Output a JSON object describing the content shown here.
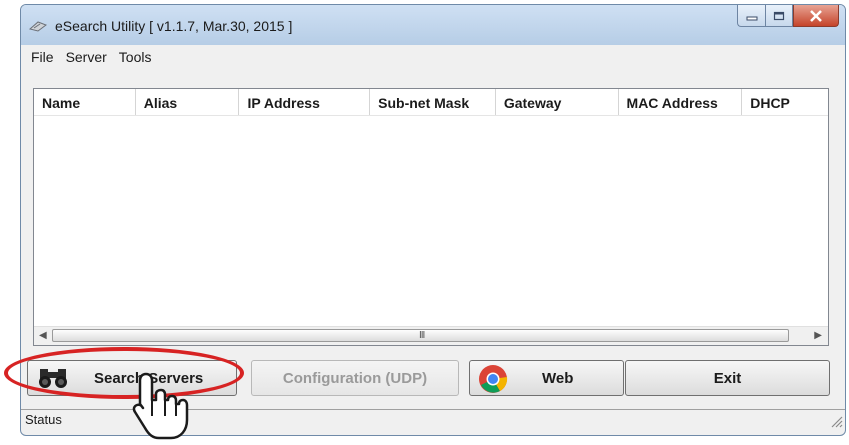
{
  "window": {
    "title": "eSearch Utility [ v1.1.7, Mar.30, 2015 ]"
  },
  "menu": {
    "items": [
      "File",
      "Server",
      "Tools"
    ]
  },
  "table": {
    "columns": [
      "Name",
      "Alias",
      "IP Address",
      "Sub-net Mask",
      "Gateway",
      "MAC Address",
      "DHCP"
    ],
    "rows": []
  },
  "buttons": {
    "search_servers": "Search Servers",
    "configuration": "Configuration (UDP)",
    "web": "Web",
    "exit": "Exit"
  },
  "status": {
    "text": "Status"
  },
  "icons": {
    "app": "network-icon",
    "search": "binoculars-icon",
    "web": "chrome-icon",
    "cursor": "hand-pointer-icon"
  },
  "colors": {
    "highlight": "#d72323",
    "close_button": "#c5442b"
  },
  "scrollbar_grip": "III"
}
